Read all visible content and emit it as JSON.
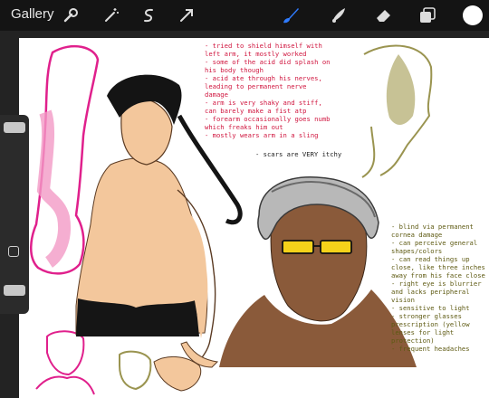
{
  "toolbar": {
    "gallery_label": "Gallery",
    "left_tools": [
      "wrench-icon",
      "magic-wand-icon",
      "selection-s-icon",
      "transform-arrow-icon"
    ],
    "right_tools": [
      "brush-icon",
      "smudge-icon",
      "eraser-icon",
      "layers-icon"
    ],
    "active_tool": "brush-icon",
    "accent_color": "#2f7bff",
    "current_color": "#ffffff"
  },
  "notes": {
    "arm": "- tried to shield himself with\nleft arm, it mostly worked\n- some of the acid did splash on\nhis body though\n- acid ate through his nerves,\nleading to permanent nerve\ndamage\n- arm is very shaky and stiff,\ncan barely make a fist atp\n- forearm occasionally goes numb\nwhich freaks him out\n- mostly wears arm in a sling",
    "scars": "- scars are VERY itchy",
    "eyes": "- blind via permanent\ncornea damage\n- can perceive general\nshapes/colors\n- can read things up\nclose, like three inches\naway from his face close\n- right eye is blurrier\nand lacks peripheral\nvision\n- sensitive to light\n- stronger glasses\nprescription (yellow\nlenses for light\nprotection)\n- frequent headaches"
  },
  "colors": {
    "note_red": "#d0163f",
    "note_olive": "#5e5a12",
    "sketch_pink": "#e0208c",
    "sketch_olive": "#9a9450",
    "skin_light": "#f3c79c",
    "skin_dark": "#8a5a3a"
  }
}
